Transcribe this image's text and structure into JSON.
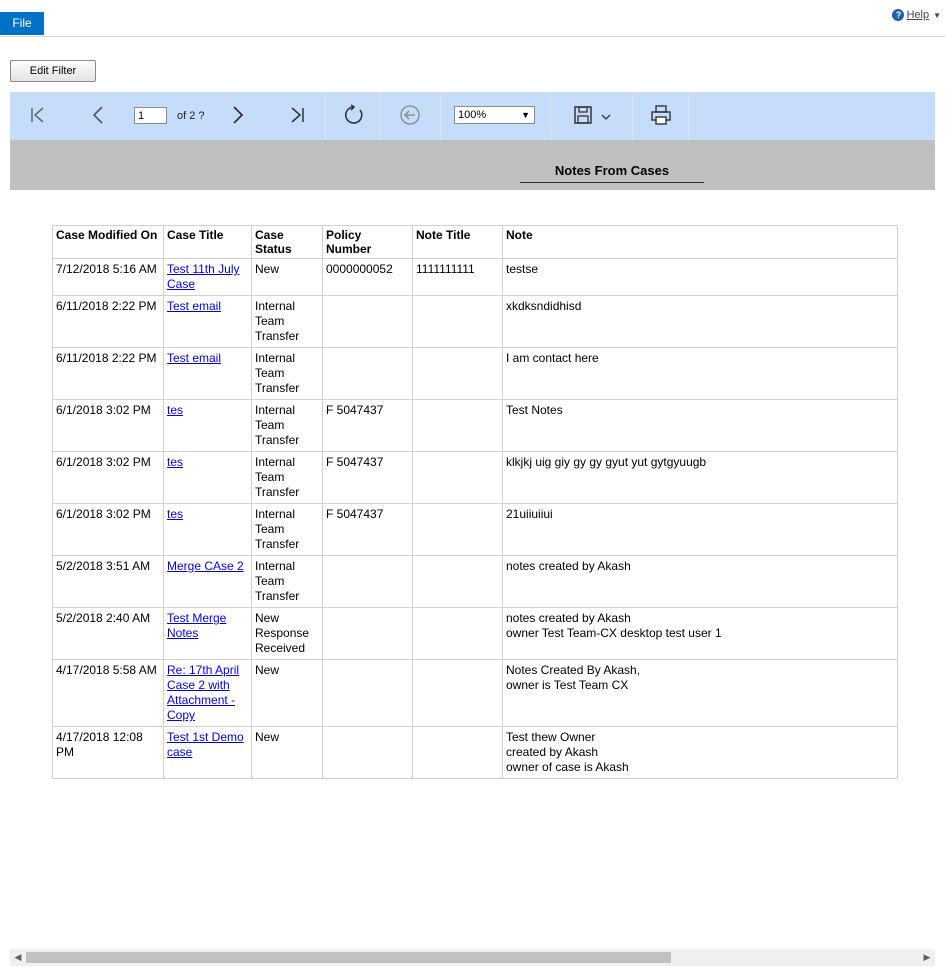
{
  "topbar": {
    "file_label": "File",
    "help_label": "Help"
  },
  "edit_filter_label": "Edit Filter",
  "toolbar": {
    "page_value": "1",
    "page_of": "of 2 ?",
    "zoom_value": "100%"
  },
  "report": {
    "title": "Notes From Cases"
  },
  "table": {
    "headers": [
      "Case Modified On",
      "Case Title",
      "Case Status",
      "Policy Number",
      "Note Title",
      "Note"
    ],
    "rows": [
      {
        "modified": "7/12/2018 5:16 AM",
        "title": "Test 11th July Case",
        "status": "New",
        "policy": "0000000052",
        "note_title": "1111111111",
        "note": "testse"
      },
      {
        "modified": "6/11/2018 2:22 PM",
        "title": "Test email",
        "status": "Internal Team Transfer",
        "policy": "",
        "note_title": "",
        "note": "xkdksndidhisd"
      },
      {
        "modified": "6/11/2018 2:22 PM",
        "title": "Test email",
        "status": "Internal Team Transfer",
        "policy": "",
        "note_title": "",
        "note": "I am contact here"
      },
      {
        "modified": "6/1/2018 3:02 PM",
        "title": "tes",
        "status": "Internal Team Transfer",
        "policy": "F  5047437",
        "note_title": "",
        "note": "Test Notes"
      },
      {
        "modified": "6/1/2018 3:02 PM",
        "title": "tes",
        "status": "Internal Team Transfer",
        "policy": "F  5047437",
        "note_title": "",
        "note": "klkjkj uig giy gy gy gyut yut gytgyuugb"
      },
      {
        "modified": "6/1/2018 3:02 PM",
        "title": "tes",
        "status": "Internal Team Transfer",
        "policy": "F  5047437",
        "note_title": "",
        "note": "21uiiuiiui"
      },
      {
        "modified": "5/2/2018 3:51 AM",
        "title": "Merge CAse 2",
        "status": "Internal Team Transfer",
        "policy": "",
        "note_title": "",
        "note": "notes created by Akash"
      },
      {
        "modified": "5/2/2018 2:40 AM",
        "title": "Test Merge Notes",
        "status": "New Response Received",
        "policy": "",
        "note_title": "",
        "note": "notes created by Akash\nowner Test Team-CX desktop test user 1"
      },
      {
        "modified": "4/17/2018 5:58 AM",
        "title": "Re: 17th April Case 2 with Attachment - Copy",
        "status": "New",
        "policy": "",
        "note_title": "",
        "note": "Notes  Created By Akash,\nowner is Test Team CX"
      },
      {
        "modified": "4/17/2018 12:08 PM",
        "title": "Test 1st Demo case",
        "status": "New",
        "policy": "",
        "note_title": "",
        "note": "Test thew Owner\ncreated by Akash\nowner of case is Akash"
      }
    ]
  }
}
